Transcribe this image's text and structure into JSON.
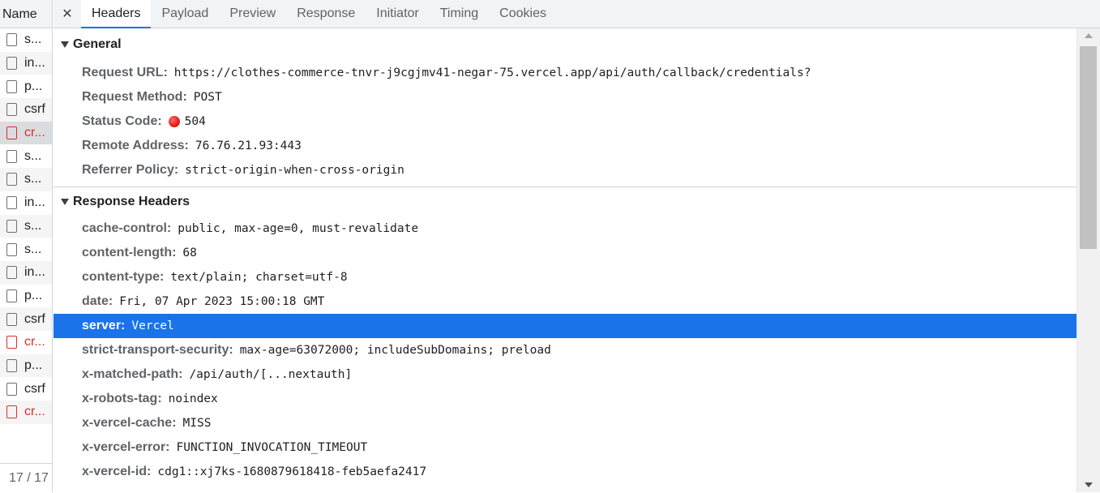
{
  "request_list": {
    "header": "Name",
    "items": [
      {
        "name": "s...",
        "error": false
      },
      {
        "name": "in...",
        "error": false
      },
      {
        "name": "p...",
        "error": false
      },
      {
        "name": "csrf",
        "error": false
      },
      {
        "name": "cr...",
        "error": true,
        "selected": true
      },
      {
        "name": "s...",
        "error": false
      },
      {
        "name": "s...",
        "error": false
      },
      {
        "name": "in...",
        "error": false
      },
      {
        "name": "s...",
        "error": false
      },
      {
        "name": "s...",
        "error": false
      },
      {
        "name": "in...",
        "error": false
      },
      {
        "name": "p...",
        "error": false
      },
      {
        "name": "csrf",
        "error": false
      },
      {
        "name": "cr...",
        "error": true
      },
      {
        "name": "p...",
        "error": false
      },
      {
        "name": "csrf",
        "error": false
      },
      {
        "name": "cr...",
        "error": true
      }
    ],
    "footer": "17 / 17"
  },
  "tabs": {
    "close_glyph": "✕",
    "items": [
      "Headers",
      "Payload",
      "Preview",
      "Response",
      "Initiator",
      "Timing",
      "Cookies"
    ],
    "active": "Headers"
  },
  "general": {
    "title": "General",
    "rows": [
      {
        "key": "Request URL:",
        "value": "https://clothes-commerce-tnvr-j9cgjmv41-negar-75.vercel.app/api/auth/callback/credentials?"
      },
      {
        "key": "Request Method:",
        "value": "POST"
      },
      {
        "key": "Status Code:",
        "value": "504",
        "status_color": "#e8201a"
      },
      {
        "key": "Remote Address:",
        "value": "76.76.21.93:443"
      },
      {
        "key": "Referrer Policy:",
        "value": "strict-origin-when-cross-origin"
      }
    ]
  },
  "response_headers": {
    "title": "Response Headers",
    "rows": [
      {
        "key": "cache-control:",
        "value": "public, max-age=0, must-revalidate"
      },
      {
        "key": "content-length:",
        "value": "68"
      },
      {
        "key": "content-type:",
        "value": "text/plain; charset=utf-8"
      },
      {
        "key": "date:",
        "value": "Fri, 07 Apr 2023 15:00:18 GMT"
      },
      {
        "key": "server:",
        "value": "Vercel",
        "highlighted": true
      },
      {
        "key": "strict-transport-security:",
        "value": "max-age=63072000; includeSubDomains; preload"
      },
      {
        "key": "x-matched-path:",
        "value": "/api/auth/[...nextauth]"
      },
      {
        "key": "x-robots-tag:",
        "value": "noindex"
      },
      {
        "key": "x-vercel-cache:",
        "value": "MISS"
      },
      {
        "key": "x-vercel-error:",
        "value": "FUNCTION_INVOCATION_TIMEOUT"
      },
      {
        "key": "x-vercel-id:",
        "value": "cdg1::xj7ks-1680879618418-feb5aefa2417"
      }
    ]
  },
  "colors": {
    "accent": "#1a73e8",
    "error": "#d93025"
  }
}
